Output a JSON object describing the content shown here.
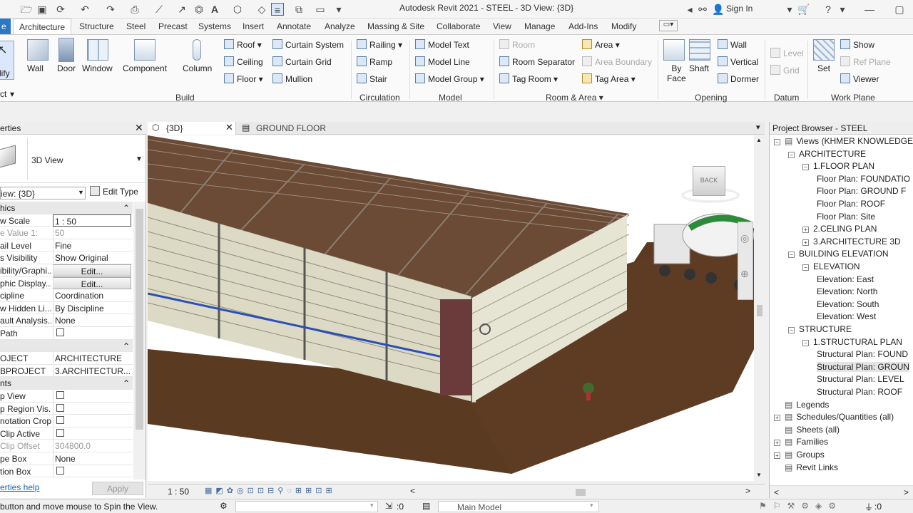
{
  "title": "Autodesk Revit 2021 - STEEL - 3D View: {3D}",
  "signin": "Sign In",
  "tabs": [
    "Architecture",
    "Structure",
    "Steel",
    "Precast",
    "Systems",
    "Insert",
    "Annotate",
    "Analyze",
    "Massing & Site",
    "Collaborate",
    "View",
    "Manage",
    "Add-Ins",
    "Modify"
  ],
  "modify_tab_partial": "e",
  "ribbon": {
    "modify": "dify",
    "select": "ct",
    "build": {
      "wall": "Wall",
      "door": "Door",
      "window": "Window",
      "component": "Component",
      "column": "Column",
      "roof": "Roof",
      "ceiling": "Ceiling",
      "floor": "Floor",
      "curtain_system": "Curtain System",
      "curtain_grid": "Curtain Grid",
      "mullion": "Mullion",
      "label": "Build"
    },
    "circulation": {
      "railing": "Railing",
      "ramp": "Ramp",
      "stair": "Stair",
      "label": "Circulation"
    },
    "model": {
      "text": "Model  Text",
      "line": "Model  Line",
      "group": "Model  Group",
      "label": "Model"
    },
    "room": {
      "room": "Room",
      "sep": "Room  Separator",
      "tag": "Tag  Room",
      "area": "Area",
      "boundary": "Area  Boundary",
      "tagarea": "Tag  Area",
      "label": "Room & Area"
    },
    "opening": {
      "byface1": "By",
      "byface2": "Face",
      "shaft": "Shaft",
      "wall": "Wall",
      "vertical": "Vertical",
      "dormer": "Dormer",
      "label": "Opening"
    },
    "datum": {
      "level": "Level",
      "grid": "Grid",
      "label": "Datum"
    },
    "workplane": {
      "set": "Set",
      "show": "Show",
      "refplane": "Ref  Plane",
      "viewer": "Viewer",
      "label": "Work Plane"
    }
  },
  "props": {
    "title": "erties",
    "type": "3D View",
    "selector": "iew: {3D}",
    "edit_type": "Edit Type",
    "rows": [
      {
        "k": "hics",
        "v": "",
        "hdr": true
      },
      {
        "k": "w Scale",
        "v": "1 : 50"
      },
      {
        "k": "e Value   1:",
        "v": "50",
        "grey": true
      },
      {
        "k": "ail Level",
        "v": "Fine"
      },
      {
        "k": "s Visibility",
        "v": "Show Original"
      },
      {
        "k": "ibility/Graphi...",
        "v": "Edit...",
        "btn": true
      },
      {
        "k": "phic Display...",
        "v": "Edit...",
        "btn": true
      },
      {
        "k": "cipline",
        "v": "Coordination"
      },
      {
        "k": "w Hidden Li...",
        "v": "By Discipline"
      },
      {
        "k": "ault Analysis...",
        "v": "None"
      },
      {
        "k": " Path",
        "v": "",
        "cb": true
      },
      {
        "k": "",
        "v": "",
        "hdr": true
      },
      {
        "k": "OJECT",
        "v": "ARCHITECTURE"
      },
      {
        "k": "BPROJECT",
        "v": "3.ARCHITECTUR..."
      },
      {
        "k": "nts",
        "v": "",
        "hdr": true
      },
      {
        "k": "p View",
        "v": "",
        "cb": true
      },
      {
        "k": "p Region Vis...",
        "v": "",
        "cb": true
      },
      {
        "k": "notation Crop",
        "v": "",
        "cb": true
      },
      {
        "k": "Clip Active",
        "v": "",
        "cb": true
      },
      {
        "k": "Clip Offset",
        "v": "304800.0",
        "grey": true
      },
      {
        "k": "pe Box",
        "v": "None"
      },
      {
        "k": "tion Box",
        "v": "",
        "cb": true
      }
    ],
    "help": "erties help",
    "apply": "Apply"
  },
  "view": {
    "tab1": "{3D}",
    "tab2": "GROUND FLOOR",
    "scale": "1 : 50",
    "cube": "BACK"
  },
  "browser": {
    "title": "Project Browser - STEEL",
    "nodes": [
      {
        "t": "Views (KHMER KNOWLEDGE)",
        "lvl": 0,
        "tog": "−"
      },
      {
        "t": "ARCHITECTURE",
        "lvl": 1,
        "tog": "−"
      },
      {
        "t": "1.FLOOR PLAN",
        "lvl": 2,
        "tog": "−"
      },
      {
        "t": "Floor Plan: FOUNDATIO",
        "lvl": 3
      },
      {
        "t": "Floor Plan: GROUND F",
        "lvl": 3
      },
      {
        "t": "Floor Plan: ROOF",
        "lvl": 3
      },
      {
        "t": "Floor Plan: Site",
        "lvl": 3
      },
      {
        "t": "2.CELING PLAN",
        "lvl": 2,
        "tog": "+"
      },
      {
        "t": "3.ARCHITECTURE 3D",
        "lvl": 2,
        "tog": "+"
      },
      {
        "t": "BUILDING ELEVATION",
        "lvl": 1,
        "tog": "−"
      },
      {
        "t": "ELEVATION",
        "lvl": 2,
        "tog": "−"
      },
      {
        "t": "Elevation: East",
        "lvl": 3
      },
      {
        "t": "Elevation: North",
        "lvl": 3
      },
      {
        "t": "Elevation: South",
        "lvl": 3
      },
      {
        "t": "Elevation: West",
        "lvl": 3
      },
      {
        "t": "STRUCTURE",
        "lvl": 1,
        "tog": "−"
      },
      {
        "t": "1.STRUCTURAL PLAN",
        "lvl": 2,
        "tog": "−"
      },
      {
        "t": "Structural Plan: FOUND",
        "lvl": 3
      },
      {
        "t": "Structural Plan: GROUN",
        "lvl": 3,
        "sel": true
      },
      {
        "t": "Structural Plan: LEVEL",
        "lvl": 3
      },
      {
        "t": "Structural Plan: ROOF",
        "lvl": 3
      },
      {
        "t": "Legends",
        "lvl": 0
      },
      {
        "t": "Schedules/Quantities (all)",
        "lvl": 0,
        "tog": "+"
      },
      {
        "t": "Sheets (all)",
        "lvl": 0
      },
      {
        "t": "Families",
        "lvl": 0,
        "tog": "+"
      },
      {
        "t": "Groups",
        "lvl": 0,
        "tog": "+"
      },
      {
        "t": "Revit Links",
        "lvl": 0
      }
    ]
  },
  "status": {
    "hint": "button and move mouse to Spin the View.",
    "sel": ":0",
    "model": "Main Model",
    "filter": ":0"
  }
}
